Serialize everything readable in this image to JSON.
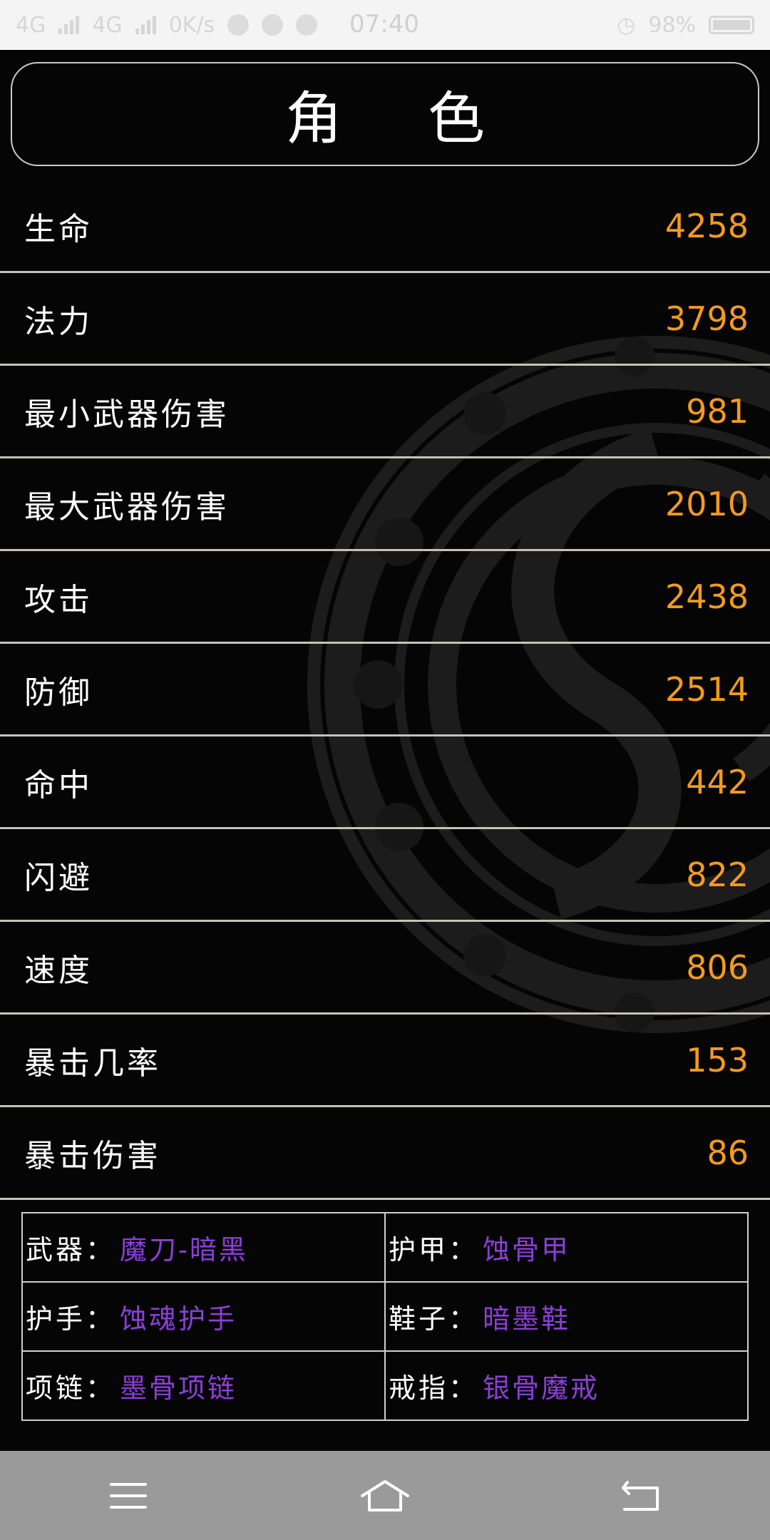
{
  "status_bar": {
    "network_1": "4G",
    "network_2": "4G",
    "speed": "0K/s",
    "time": "07:40",
    "battery": "98%"
  },
  "header": {
    "title": "角色"
  },
  "stats": [
    {
      "label": "生命",
      "value": "4258"
    },
    {
      "label": "法力",
      "value": "3798"
    },
    {
      "label": "最小武器伤害",
      "value": "981"
    },
    {
      "label": "最大武器伤害",
      "value": "2010"
    },
    {
      "label": "攻击",
      "value": "2438"
    },
    {
      "label": "防御",
      "value": "2514"
    },
    {
      "label": "命中",
      "value": "442"
    },
    {
      "label": "闪避",
      "value": "822"
    },
    {
      "label": "速度",
      "value": "806"
    },
    {
      "label": "暴击几率",
      "value": "153"
    },
    {
      "label": "暴击伤害",
      "value": "86"
    }
  ],
  "equipment": [
    {
      "label": "武器：",
      "value": "魔刀-暗黑"
    },
    {
      "label": "护甲：",
      "value": "蚀骨甲"
    },
    {
      "label": "护手：",
      "value": "蚀魂护手"
    },
    {
      "label": "鞋子：",
      "value": "暗墨鞋"
    },
    {
      "label": "项链：",
      "value": "墨骨项链"
    },
    {
      "label": "戒指：",
      "value": "银骨魔戒"
    }
  ],
  "colors": {
    "value": "#f39a1f",
    "equipment_value": "#8a3fd6",
    "divider": "#c8c2b6",
    "nav_bg": "#9a9a9a"
  },
  "nav": {
    "icons": [
      "menu-icon",
      "home-icon",
      "back-icon"
    ]
  }
}
